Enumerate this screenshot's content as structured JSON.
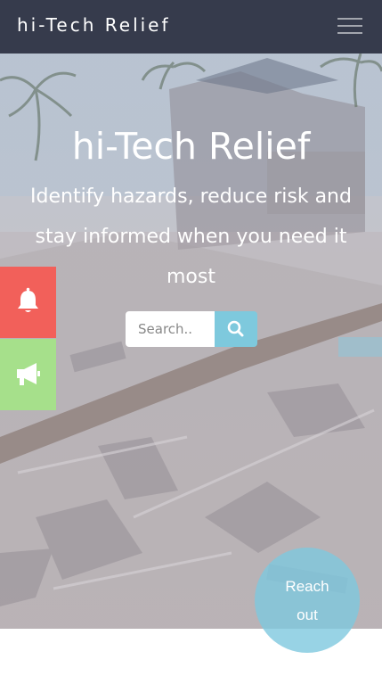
{
  "navbar": {
    "brand": "hi-Tech Relief",
    "menu_icon": "hamburger-menu-icon"
  },
  "hero": {
    "title": "hi-Tech Relief",
    "subtitle": "Identify hazards, reduce risk and stay informed when you need it most",
    "background": "disaster debris photo"
  },
  "search": {
    "placeholder": "Search..",
    "button_icon": "search-icon"
  },
  "side_buttons": [
    {
      "icon": "bell-icon",
      "color": "#f2605a"
    },
    {
      "icon": "megaphone-icon",
      "color": "#a6e08b"
    }
  ],
  "reach_out": {
    "line1": "Reach",
    "line2": "out",
    "color": "#7ec8de"
  },
  "colors": {
    "navbar": "#363b4c",
    "accent": "#7ec9dd"
  }
}
